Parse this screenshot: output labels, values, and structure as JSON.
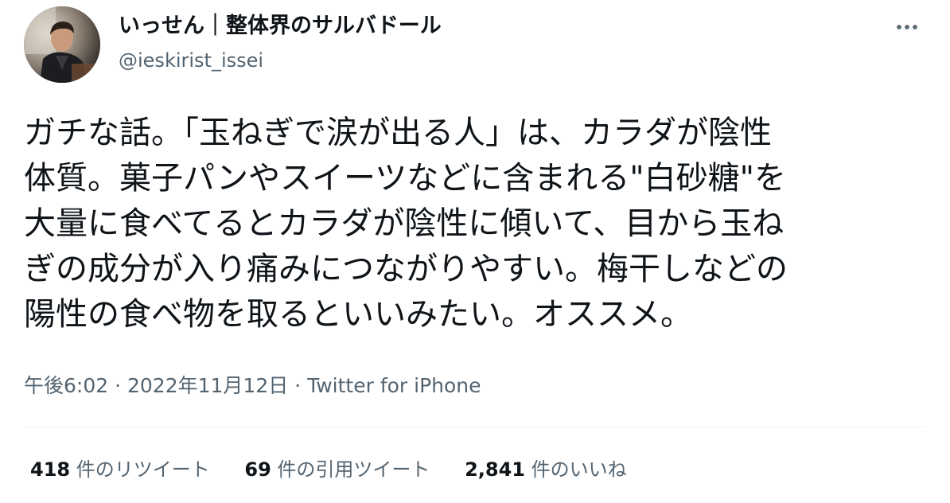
{
  "author": {
    "display_name": "いっせん｜整体界のサルバドール",
    "handle": "@ieskirist_issei",
    "avatar_icon": "profile-photo"
  },
  "menu": {
    "icon": "more-horizontal-icon"
  },
  "tweet": {
    "text": "ガチな話。「玉ねぎで涙が出る人」は、カラダが陰性\n体質。菓子パンやスイーツなどに含まれる\"白砂糖\"を\n大量に食べてるとカラダが陰性に傾いて、目から玉ね\nぎの成分が入り痛みにつながりやすい。梅干しなどの\n陽性の食べ物を取るといいみたい。オススメ。",
    "time": "午後6:02",
    "sep": " · ",
    "date": "2022年11月12日",
    "source": "Twitter for iPhone"
  },
  "stats": {
    "retweets_count": "418",
    "retweets_label": " 件のリツイート",
    "quotes_count": "69",
    "quotes_label": " 件の引用ツイート",
    "likes_count": "2,841",
    "likes_label": " 件のいいね"
  },
  "colors": {
    "text": "#0f1419",
    "secondary": "#536471",
    "divider": "#eff3f4"
  }
}
